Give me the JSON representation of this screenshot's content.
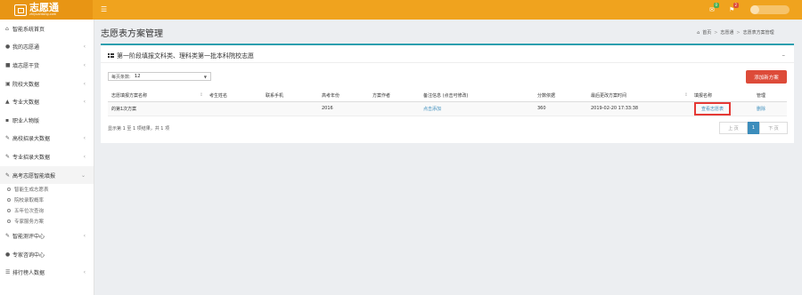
{
  "app": {
    "logo_text": "志愿通",
    "logo_sub": "zhiyuantong.com",
    "menu_icon": "hamburger-icon",
    "notifications": [
      {
        "icon": "mail-icon",
        "count": "0",
        "color": "#4caf50"
      },
      {
        "icon": "bell-icon",
        "count": "2",
        "color": "#dd4b39"
      }
    ]
  },
  "sidebar": {
    "items": [
      {
        "label": "智能系统首页",
        "icon": "home-icon",
        "has_children": false
      },
      {
        "label": "我的志愿通",
        "icon": "user-icon",
        "has_children": true
      },
      {
        "label": "填志愿干货",
        "icon": "book-icon",
        "has_children": true
      },
      {
        "label": "院校大数据",
        "icon": "building-icon",
        "has_children": true
      },
      {
        "label": "专业大数据",
        "icon": "graduation-icon",
        "has_children": true
      },
      {
        "label": "职业人物版",
        "icon": "briefcase-icon",
        "has_children": false
      },
      {
        "label": "高校招录大数据",
        "icon": "edit-icon",
        "has_children": true
      },
      {
        "label": "专业招录大数据",
        "icon": "edit-icon",
        "has_children": true
      },
      {
        "label": "高考志愿智能填报",
        "icon": "edit-icon",
        "has_children": true,
        "expanded": true
      }
    ],
    "sub_items": [
      "智能生成志愿表",
      "院校录取概率",
      "五年位次查询",
      "专家服务方案"
    ],
    "bottom_items": [
      {
        "label": "智能测评中心",
        "icon": "edit-icon",
        "has_children": true
      },
      {
        "label": "专家咨询中心",
        "icon": "chat-icon",
        "has_children": false
      },
      {
        "label": "排行榜人数据",
        "icon": "list-icon",
        "has_children": true
      }
    ]
  },
  "header": {
    "title": "志愿表方案管理",
    "breadcrumb": [
      "首页",
      "志愿通",
      "志愿表方案管理"
    ],
    "breadcrumb_icon": "home-icon"
  },
  "panel": {
    "title": "第一阶段填报文科类、理科类第一批本科院校志愿",
    "title_icon": "grid-icon",
    "collapse_icon": "minus-icon",
    "per_page_label": "每页条数:",
    "per_page_value": "12",
    "new_button": "添加新方案",
    "columns": [
      "志愿填报方案名称",
      "考生姓名",
      "联系手机",
      "高考年份",
      "方案作者",
      "备注信息 (点击可修改)",
      "分数依据",
      "最后更改方案时间",
      "填报名称",
      "管理"
    ],
    "rows": [
      {
        "name": "的第1次方案",
        "student": "",
        "phone": "",
        "year": "2016",
        "author": "",
        "note": "点击添加",
        "score": "360",
        "modified": "2019-02-20 17:33:38",
        "view": "查看志愿表",
        "manage": "删除"
      }
    ],
    "footer_info": "显示第 1 至 1 项结果，共 1 项",
    "pager": {
      "prev": "上 页",
      "current": "1",
      "next": "下 页"
    }
  }
}
